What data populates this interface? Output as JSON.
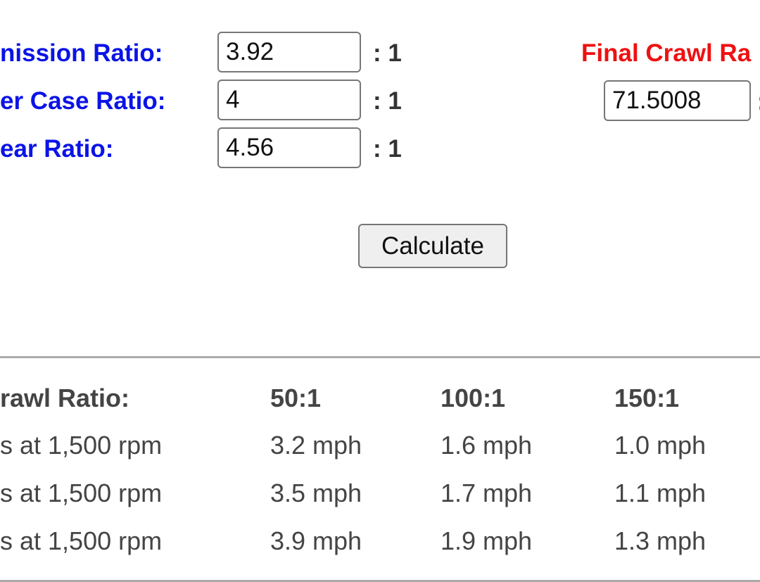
{
  "inputs": [
    {
      "label": "nission Ratio:",
      "value": "3.92",
      "suffix": ": 1"
    },
    {
      "label": "er Case Ratio:",
      "value": "4",
      "suffix": ": 1"
    },
    {
      "label": "ear Ratio:",
      "value": "4.56",
      "suffix": ": 1"
    }
  ],
  "result": {
    "label": "Final Crawl Ra",
    "value": "71.5008",
    "suffix": ":"
  },
  "calculate_label": "Calculate",
  "table": {
    "header": [
      "rawl Ratio:",
      "50:1",
      "100:1",
      "150:1"
    ],
    "rows": [
      [
        "s at 1,500 rpm",
        "3.2 mph",
        "1.6 mph",
        "1.0 mph"
      ],
      [
        "s at 1,500 rpm",
        "3.5 mph",
        "1.7 mph",
        "1.1 mph"
      ],
      [
        "s at 1,500 rpm",
        "3.9 mph",
        "1.9 mph",
        "1.3 mph"
      ]
    ]
  },
  "colors": {
    "label_blue": "#0a14e6",
    "result_red": "#ee1111"
  }
}
